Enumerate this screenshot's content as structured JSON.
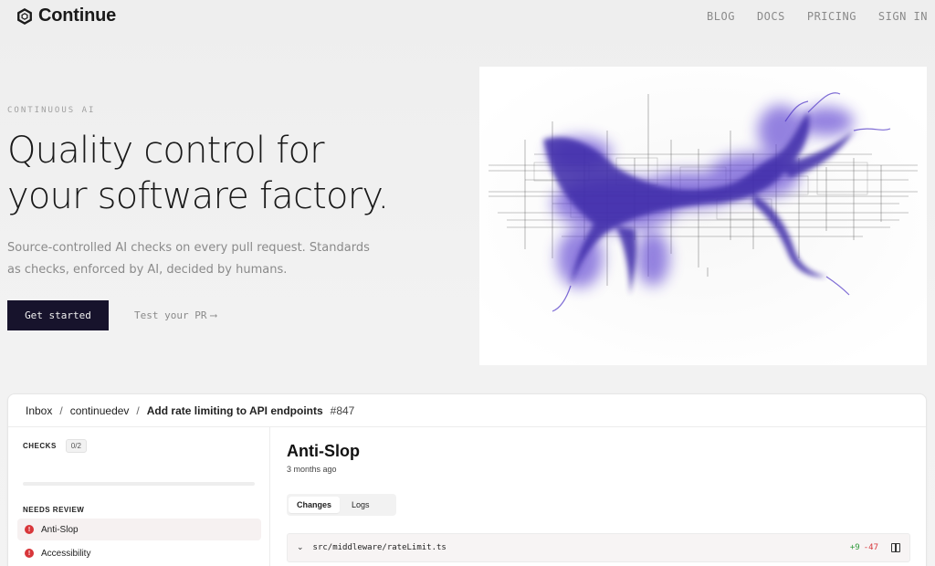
{
  "brand": {
    "name": "Continue"
  },
  "nav": {
    "items": [
      "BLOG",
      "DOCS",
      "PRICING",
      "SIGN IN"
    ]
  },
  "hero": {
    "eyebrow": "CONTINUOUS AI",
    "headline_line1": "Quality control for",
    "headline_line2": "your software factory.",
    "subtext": "Source-controlled AI checks on every pull request. Standards as checks, enforced by AI, decided by humans.",
    "cta_primary": "Get started",
    "cta_secondary": "Test your PR",
    "cta_secondary_arrow": "⟶"
  },
  "panel": {
    "breadcrumb": {
      "inbox": "Inbox",
      "sep": "/",
      "org": "continuedev",
      "pr_title": "Add rate limiting to API endpoints",
      "pr_number": "#847"
    },
    "sidebar": {
      "checks_label": "CHECKS",
      "checks_count": "0/2",
      "checks_progress": 0,
      "section_label": "NEEDS REVIEW",
      "items": [
        {
          "label": "Anti-Slop",
          "status": "!"
        },
        {
          "label": "Accessibility",
          "status": "!"
        }
      ]
    },
    "main": {
      "title": "Anti-Slop",
      "time": "3 months ago",
      "tabs": [
        "Changes",
        "Logs"
      ],
      "file": {
        "chevron": "⌄",
        "path": "src/middleware/rateLimit.ts",
        "additions": "+9",
        "deletions": "-47"
      }
    }
  },
  "colors": {
    "primary_button": "#17132c",
    "accent": "#5b3fd1",
    "warning": "#d8363a",
    "addition": "#2f9a3b"
  },
  "icons": [
    "continue-logo-icon",
    "arrow-right-icon",
    "warning-icon",
    "chevron-down-icon",
    "split-view-icon"
  ]
}
